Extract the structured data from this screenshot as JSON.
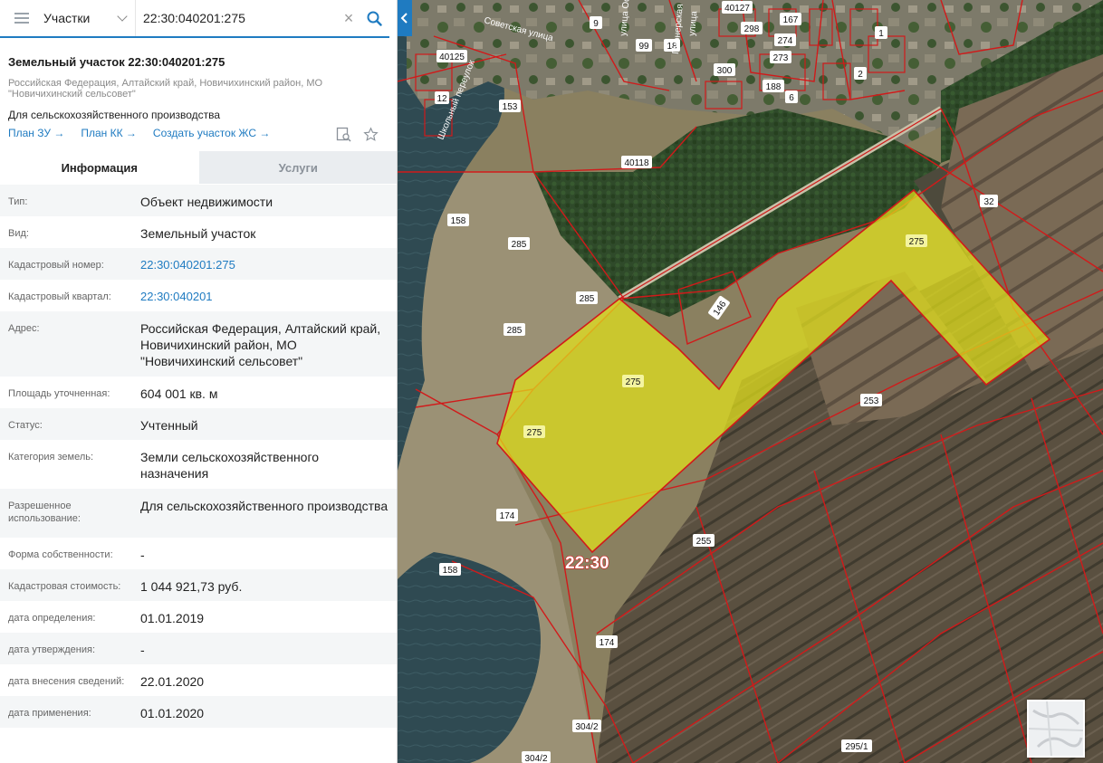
{
  "search": {
    "layer": "Участки",
    "query": "22:30:040201:275",
    "clear_symbol": "×"
  },
  "parcel": {
    "title": "Земельный участок 22:30:040201:275",
    "address_line1": "Российская Федерация, Алтайский край, Новичихинский район, МО",
    "address_line2": "\"Новичихинский сельсовет\"",
    "use": "Для сельскохозяйственного производства"
  },
  "links": {
    "plan_zu": "План ЗУ →",
    "plan_kk": "План КК →",
    "create_zhs": "Создать участок ЖС →"
  },
  "tabs": {
    "info": "Информация",
    "services": "Услуги"
  },
  "info_rows": [
    {
      "k": "Тип:",
      "v": "Объект недвижимости"
    },
    {
      "k": "Вид:",
      "v": "Земельный участок"
    },
    {
      "k": "Кадастровый номер:",
      "v": "22:30:040201:275"
    },
    {
      "k": "Кадастровый квартал:",
      "v": "22:30:040201"
    },
    {
      "k": "Адрес:",
      "v": "Российская Федерация, Алтайский край, Новичихинский район, МО \"Новичихинский сельсовет\""
    },
    {
      "k": "Площадь уточненная:",
      "v": "604 001 кв. м"
    },
    {
      "k": "Статус:",
      "v": "Учтенный"
    },
    {
      "k": "Категория земель:",
      "v": "Земли сельскохозяйственного назначения"
    },
    {
      "k": "Разрешенное использование:",
      "v": "Для сельскохозяйственного производства"
    },
    {
      "k": "Форма собственности:",
      "v": "-"
    },
    {
      "k": "Кадастровая стоимость:",
      "v": "1 044 921,73 руб."
    },
    {
      "k": "дата определения:",
      "v": "01.01.2019"
    },
    {
      "k": "дата утверждения:",
      "v": "-"
    },
    {
      "k": "дата внесения сведений:",
      "v": "22.01.2020"
    },
    {
      "k": "дата применения:",
      "v": "01.01.2020"
    }
  ],
  "map": {
    "district_label": "22:30",
    "parcel_labels": [
      "275",
      "275",
      "275",
      "285",
      "285",
      "285",
      "158",
      "158",
      "153",
      "174",
      "174",
      "255",
      "253",
      "32",
      "146",
      "40118",
      "40125",
      "40127",
      "304/2",
      "304/2",
      "295/1",
      "1",
      "2",
      "6",
      "9",
      "12",
      "18",
      "99",
      "167",
      "188",
      "273",
      "274",
      "298",
      "300"
    ],
    "street_labels": [
      "Советская улица",
      "Школьный переулок",
      "улица Ос",
      "улица",
      "Пионерская"
    ],
    "colors": {
      "highlight_fill": "#e3e21a",
      "boundary": "#d11a1a",
      "accent": "#1f7bc1"
    }
  }
}
